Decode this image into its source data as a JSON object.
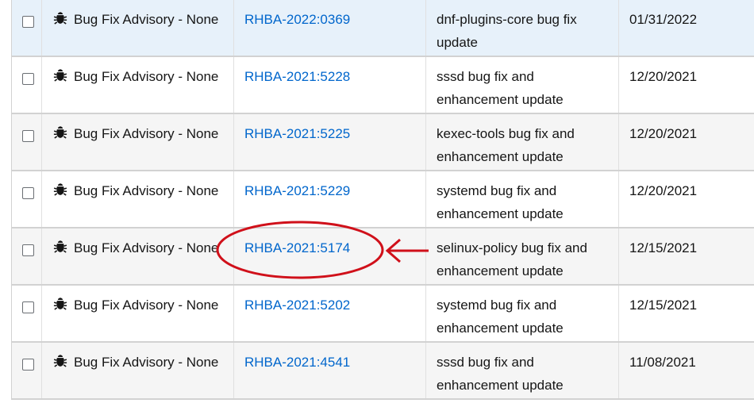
{
  "rows": [
    {
      "type": "Bug Fix Advisory - None",
      "id": "RHBA-2022:0369",
      "synopsis": "dnf-plugins-core bug fix update",
      "date": "01/31/2022"
    },
    {
      "type": "Bug Fix Advisory - None",
      "id": "RHBA-2021:5228",
      "synopsis": "sssd bug fix and enhancement update",
      "date": "12/20/2021"
    },
    {
      "type": "Bug Fix Advisory - None",
      "id": "RHBA-2021:5225",
      "synopsis": "kexec-tools bug fix and enhancement update",
      "date": "12/20/2021"
    },
    {
      "type": "Bug Fix Advisory - None",
      "id": "RHBA-2021:5229",
      "synopsis": "systemd bug fix and enhancement update",
      "date": "12/20/2021"
    },
    {
      "type": "Bug Fix Advisory - None",
      "id": "RHBA-2021:5174",
      "synopsis": "selinux-policy bug fix and enhancement update",
      "date": "12/15/2021"
    },
    {
      "type": "Bug Fix Advisory - None",
      "id": "RHBA-2021:5202",
      "synopsis": "systemd bug fix and enhancement update",
      "date": "12/15/2021"
    },
    {
      "type": "Bug Fix Advisory - None",
      "id": "RHBA-2021:4541",
      "synopsis": "sssd bug fix and enhancement update",
      "date": "11/08/2021"
    }
  ],
  "icons": {
    "advisory_type": "bug-icon",
    "annotation": "red-ellipse-and-arrow"
  },
  "colors": {
    "link": "#0066cc",
    "highlight_row": "#e7f1fa",
    "alt_row": "#f5f5f5",
    "annotation": "#d0101a"
  }
}
